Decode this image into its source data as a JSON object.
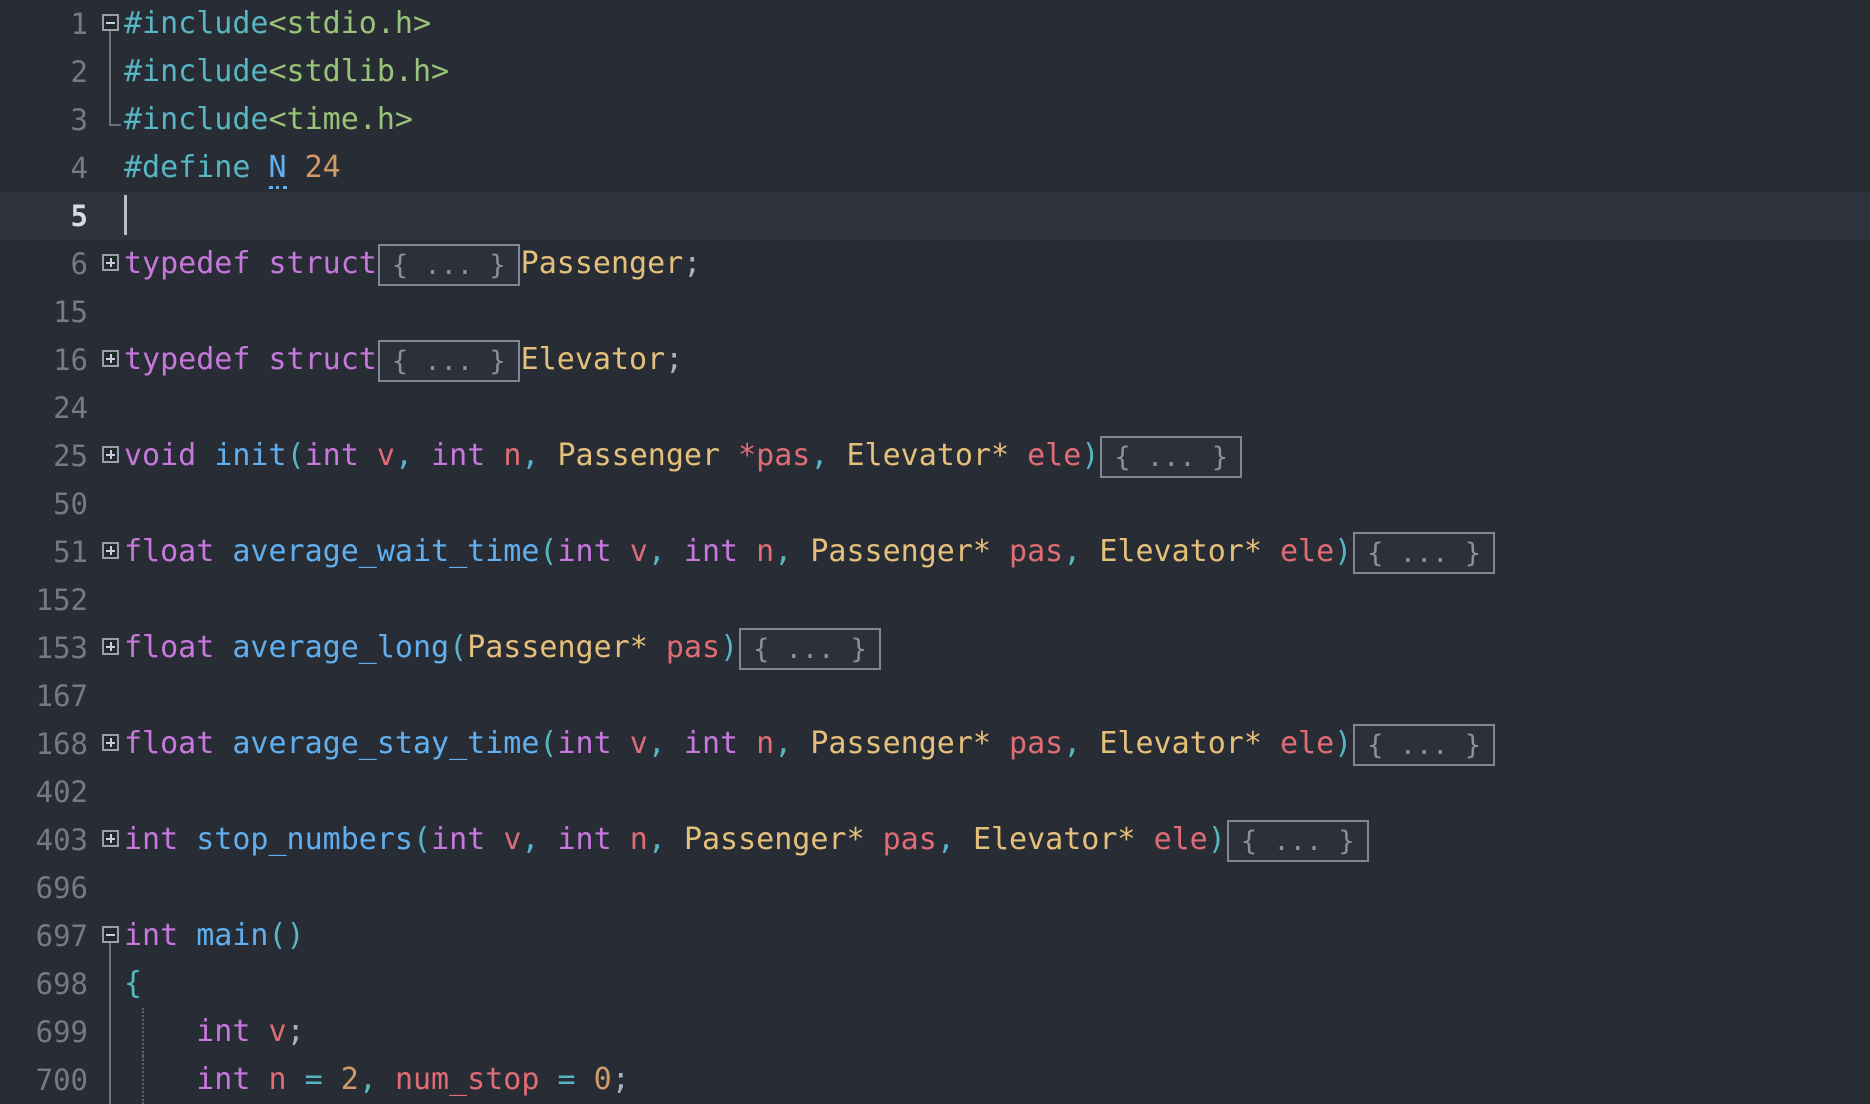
{
  "editor": {
    "language": "c",
    "theme": "one-dark",
    "colors": {
      "background": "#282c34",
      "active_line": "#2f333d",
      "gutter_text": "#737b86",
      "gutter_active_text": "#d7dae0",
      "preprocessor": "#56b6c2",
      "header_string": "#98c379",
      "keyword": "#c678dd",
      "function": "#61afef",
      "type": "#e5c07b",
      "variable": "#e06c75",
      "number": "#d19a66",
      "punctuation": "#abb2bf",
      "fold_placeholder_border": "#7f8792",
      "fold_placeholder_text": "#8b919b"
    },
    "fold_placeholder_label": "{ ... }",
    "caret_line": 5,
    "lines": [
      {
        "number": "1",
        "fold": "minus",
        "fold_guide": true,
        "tokens": [
          {
            "text": "#include",
            "cls": "t-pre"
          },
          {
            "text": "<stdio.h>",
            "cls": "t-header"
          }
        ]
      },
      {
        "number": "2",
        "fold": "none",
        "guide": "solid",
        "tokens": [
          {
            "text": "#include",
            "cls": "t-pre"
          },
          {
            "text": "<stdlib.h>",
            "cls": "t-header"
          }
        ]
      },
      {
        "number": "3",
        "fold": "none",
        "guide": "elbow",
        "tokens": [
          {
            "text": "#include",
            "cls": "t-pre"
          },
          {
            "text": "<time.h>",
            "cls": "t-header"
          }
        ]
      },
      {
        "number": "4",
        "fold": "none",
        "tokens": [
          {
            "text": "#define",
            "cls": "t-pre"
          },
          {
            "text": " ",
            "cls": "t-plain"
          },
          {
            "text": "N",
            "cls": "t-fn occ"
          },
          {
            "text": " ",
            "cls": "t-plain"
          },
          {
            "text": "24",
            "cls": "t-num"
          }
        ]
      },
      {
        "number": "5",
        "fold": "none",
        "active": true,
        "caret": true,
        "tokens": []
      },
      {
        "number": "6",
        "fold": "plus",
        "tokens": [
          {
            "text": "typedef",
            "cls": "t-kw"
          },
          {
            "text": " ",
            "cls": "t-plain"
          },
          {
            "text": "struct",
            "cls": "t-kw"
          },
          {
            "text": "{ ... }",
            "cls": "fold"
          },
          {
            "text": "Passenger",
            "cls": "t-type"
          },
          {
            "text": ";",
            "cls": "t-punc"
          }
        ]
      },
      {
        "number": "15",
        "fold": "none",
        "tokens": []
      },
      {
        "number": "16",
        "fold": "plus",
        "tokens": [
          {
            "text": "typedef",
            "cls": "t-kw"
          },
          {
            "text": " ",
            "cls": "t-plain"
          },
          {
            "text": "struct",
            "cls": "t-kw"
          },
          {
            "text": "{ ... }",
            "cls": "fold"
          },
          {
            "text": "Elevator",
            "cls": "t-type"
          },
          {
            "text": ";",
            "cls": "t-punc"
          }
        ]
      },
      {
        "number": "24",
        "fold": "none",
        "tokens": []
      },
      {
        "number": "25",
        "fold": "plus",
        "tokens": [
          {
            "text": "void",
            "cls": "t-kw"
          },
          {
            "text": " ",
            "cls": "t-plain"
          },
          {
            "text": "init",
            "cls": "t-fn"
          },
          {
            "text": "(",
            "cls": "t-paren"
          },
          {
            "text": "int",
            "cls": "t-kw"
          },
          {
            "text": " ",
            "cls": "t-plain"
          },
          {
            "text": "v",
            "cls": "t-var"
          },
          {
            "text": ",",
            "cls": "t-op"
          },
          {
            "text": " ",
            "cls": "t-plain"
          },
          {
            "text": "int",
            "cls": "t-kw"
          },
          {
            "text": " ",
            "cls": "t-plain"
          },
          {
            "text": "n",
            "cls": "t-var"
          },
          {
            "text": ",",
            "cls": "t-op"
          },
          {
            "text": " ",
            "cls": "t-plain"
          },
          {
            "text": "Passenger",
            "cls": "t-type"
          },
          {
            "text": " ",
            "cls": "t-plain"
          },
          {
            "text": "*pas",
            "cls": "t-var"
          },
          {
            "text": ",",
            "cls": "t-op"
          },
          {
            "text": " ",
            "cls": "t-plain"
          },
          {
            "text": "Elevator*",
            "cls": "t-type"
          },
          {
            "text": " ",
            "cls": "t-plain"
          },
          {
            "text": "ele",
            "cls": "t-var"
          },
          {
            "text": ")",
            "cls": "t-paren"
          },
          {
            "text": "{ ... }",
            "cls": "fold"
          }
        ]
      },
      {
        "number": "50",
        "fold": "none",
        "tokens": []
      },
      {
        "number": "51",
        "fold": "plus",
        "tokens": [
          {
            "text": "float",
            "cls": "t-kw"
          },
          {
            "text": " ",
            "cls": "t-plain"
          },
          {
            "text": "average_wait_time",
            "cls": "t-fn"
          },
          {
            "text": "(",
            "cls": "t-paren"
          },
          {
            "text": "int",
            "cls": "t-kw"
          },
          {
            "text": " ",
            "cls": "t-plain"
          },
          {
            "text": "v",
            "cls": "t-var"
          },
          {
            "text": ",",
            "cls": "t-op"
          },
          {
            "text": " ",
            "cls": "t-plain"
          },
          {
            "text": "int",
            "cls": "t-kw"
          },
          {
            "text": " ",
            "cls": "t-plain"
          },
          {
            "text": "n",
            "cls": "t-var"
          },
          {
            "text": ",",
            "cls": "t-op"
          },
          {
            "text": " ",
            "cls": "t-plain"
          },
          {
            "text": "Passenger*",
            "cls": "t-type"
          },
          {
            "text": " ",
            "cls": "t-plain"
          },
          {
            "text": "pas",
            "cls": "t-var"
          },
          {
            "text": ",",
            "cls": "t-op"
          },
          {
            "text": " ",
            "cls": "t-plain"
          },
          {
            "text": "Elevator*",
            "cls": "t-type"
          },
          {
            "text": " ",
            "cls": "t-plain"
          },
          {
            "text": "ele",
            "cls": "t-var"
          },
          {
            "text": ")",
            "cls": "t-paren"
          },
          {
            "text": "{ ... }",
            "cls": "fold"
          }
        ]
      },
      {
        "number": "152",
        "fold": "none",
        "tokens": []
      },
      {
        "number": "153",
        "fold": "plus",
        "tokens": [
          {
            "text": "float",
            "cls": "t-kw"
          },
          {
            "text": " ",
            "cls": "t-plain"
          },
          {
            "text": "average_long",
            "cls": "t-fn"
          },
          {
            "text": "(",
            "cls": "t-paren"
          },
          {
            "text": "Passenger*",
            "cls": "t-type"
          },
          {
            "text": " ",
            "cls": "t-plain"
          },
          {
            "text": "pas",
            "cls": "t-var"
          },
          {
            "text": ")",
            "cls": "t-paren"
          },
          {
            "text": "{ ... }",
            "cls": "fold"
          }
        ]
      },
      {
        "number": "167",
        "fold": "none",
        "tokens": []
      },
      {
        "number": "168",
        "fold": "plus",
        "tokens": [
          {
            "text": "float",
            "cls": "t-kw"
          },
          {
            "text": " ",
            "cls": "t-plain"
          },
          {
            "text": "average_stay_time",
            "cls": "t-fn"
          },
          {
            "text": "(",
            "cls": "t-paren"
          },
          {
            "text": "int",
            "cls": "t-kw"
          },
          {
            "text": " ",
            "cls": "t-plain"
          },
          {
            "text": "v",
            "cls": "t-var"
          },
          {
            "text": ",",
            "cls": "t-op"
          },
          {
            "text": " ",
            "cls": "t-plain"
          },
          {
            "text": "int",
            "cls": "t-kw"
          },
          {
            "text": " ",
            "cls": "t-plain"
          },
          {
            "text": "n",
            "cls": "t-var"
          },
          {
            "text": ",",
            "cls": "t-op"
          },
          {
            "text": " ",
            "cls": "t-plain"
          },
          {
            "text": "Passenger*",
            "cls": "t-type"
          },
          {
            "text": " ",
            "cls": "t-plain"
          },
          {
            "text": "pas",
            "cls": "t-var"
          },
          {
            "text": ",",
            "cls": "t-op"
          },
          {
            "text": " ",
            "cls": "t-plain"
          },
          {
            "text": "Elevator*",
            "cls": "t-type"
          },
          {
            "text": " ",
            "cls": "t-plain"
          },
          {
            "text": "ele",
            "cls": "t-var"
          },
          {
            "text": ")",
            "cls": "t-paren"
          },
          {
            "text": "{ ... }",
            "cls": "fold"
          }
        ]
      },
      {
        "number": "402",
        "fold": "none",
        "tokens": []
      },
      {
        "number": "403",
        "fold": "plus",
        "tokens": [
          {
            "text": "int",
            "cls": "t-kw"
          },
          {
            "text": " ",
            "cls": "t-plain"
          },
          {
            "text": "stop_numbers",
            "cls": "t-fn"
          },
          {
            "text": "(",
            "cls": "t-paren"
          },
          {
            "text": "int",
            "cls": "t-kw"
          },
          {
            "text": " ",
            "cls": "t-plain"
          },
          {
            "text": "v",
            "cls": "t-var"
          },
          {
            "text": ",",
            "cls": "t-op"
          },
          {
            "text": " ",
            "cls": "t-plain"
          },
          {
            "text": "int",
            "cls": "t-kw"
          },
          {
            "text": " ",
            "cls": "t-plain"
          },
          {
            "text": "n",
            "cls": "t-var"
          },
          {
            "text": ",",
            "cls": "t-op"
          },
          {
            "text": " ",
            "cls": "t-plain"
          },
          {
            "text": "Passenger*",
            "cls": "t-type"
          },
          {
            "text": " ",
            "cls": "t-plain"
          },
          {
            "text": "pas",
            "cls": "t-var"
          },
          {
            "text": ",",
            "cls": "t-op"
          },
          {
            "text": " ",
            "cls": "t-plain"
          },
          {
            "text": "Elevator*",
            "cls": "t-type"
          },
          {
            "text": " ",
            "cls": "t-plain"
          },
          {
            "text": "ele",
            "cls": "t-var"
          },
          {
            "text": ")",
            "cls": "t-paren"
          },
          {
            "text": "{ ... }",
            "cls": "fold"
          }
        ]
      },
      {
        "number": "696",
        "fold": "none",
        "tokens": []
      },
      {
        "number": "697",
        "fold": "minus",
        "fold_guide": true,
        "tokens": [
          {
            "text": "int",
            "cls": "t-kw"
          },
          {
            "text": " ",
            "cls": "t-plain"
          },
          {
            "text": "main",
            "cls": "t-fn"
          },
          {
            "text": "()",
            "cls": "t-paren"
          }
        ]
      },
      {
        "number": "698",
        "fold": "none",
        "guide": "solid",
        "tokens": [
          {
            "text": "{",
            "cls": "t-paren"
          }
        ]
      },
      {
        "number": "699",
        "fold": "none",
        "guide": "solid",
        "guide2": "dotted",
        "tokens": [
          {
            "text": "    ",
            "cls": "t-plain"
          },
          {
            "text": "int",
            "cls": "t-kw"
          },
          {
            "text": " ",
            "cls": "t-plain"
          },
          {
            "text": "v",
            "cls": "t-var"
          },
          {
            "text": ";",
            "cls": "t-punc"
          }
        ]
      },
      {
        "number": "700",
        "fold": "none",
        "guide": "solid",
        "guide2": "dotted",
        "tokens": [
          {
            "text": "    ",
            "cls": "t-plain"
          },
          {
            "text": "int",
            "cls": "t-kw"
          },
          {
            "text": " ",
            "cls": "t-plain"
          },
          {
            "text": "n",
            "cls": "t-var"
          },
          {
            "text": " ",
            "cls": "t-plain"
          },
          {
            "text": "=",
            "cls": "t-op"
          },
          {
            "text": " ",
            "cls": "t-plain"
          },
          {
            "text": "2",
            "cls": "t-num"
          },
          {
            "text": ",",
            "cls": "t-op"
          },
          {
            "text": " ",
            "cls": "t-plain"
          },
          {
            "text": "num_stop",
            "cls": "t-var"
          },
          {
            "text": " ",
            "cls": "t-plain"
          },
          {
            "text": "=",
            "cls": "t-op"
          },
          {
            "text": " ",
            "cls": "t-plain"
          },
          {
            "text": "0",
            "cls": "t-num"
          },
          {
            "text": ";",
            "cls": "t-punc"
          }
        ]
      }
    ]
  }
}
